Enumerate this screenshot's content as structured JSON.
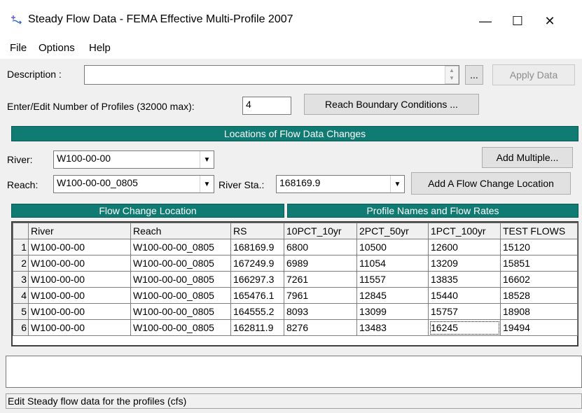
{
  "window": {
    "title": "Steady Flow Data - FEMA Effective Multi-Profile 2007",
    "minimize": "—",
    "maximize": "☐",
    "close": "✕"
  },
  "menu": [
    "File",
    "Options",
    "Help"
  ],
  "description": {
    "label": "Description :",
    "value": "",
    "ellipsis": "...",
    "apply_label": "Apply Data"
  },
  "profiles": {
    "label": "Enter/Edit Number of Profiles (32000 max):",
    "value": "4",
    "reach_bc_label": "Reach Boundary Conditions ..."
  },
  "locations": {
    "header": "Locations of Flow Data Changes",
    "river_label": "River:",
    "river_value": "W100-00-00",
    "reach_label": "Reach:",
    "reach_value": "W100-00-00_0805",
    "river_sta_label": "River Sta.:",
    "river_sta_value": "168169.9",
    "add_multiple_label": "Add Multiple...",
    "add_location_label": "Add A Flow Change Location"
  },
  "grid": {
    "left_header": "Flow Change Location",
    "right_header": "Profile Names and Flow Rates",
    "columns": [
      "River",
      "Reach",
      "RS",
      "10PCT_10yr",
      "2PCT_50yr",
      "1PCT_100yr",
      "TEST FLOWS"
    ],
    "rows": [
      [
        "1",
        "W100-00-00",
        "W100-00-00_0805",
        "168169.9",
        "6800",
        "10500",
        "12600",
        "15120"
      ],
      [
        "2",
        "W100-00-00",
        "W100-00-00_0805",
        "167249.9",
        "6989",
        "11054",
        "13209",
        "15851"
      ],
      [
        "3",
        "W100-00-00",
        "W100-00-00_0805",
        "166297.3",
        "7261",
        "11557",
        "13835",
        "16602"
      ],
      [
        "4",
        "W100-00-00",
        "W100-00-00_0805",
        "165476.1",
        "7961",
        "12845",
        "15440",
        "18528"
      ],
      [
        "5",
        "W100-00-00",
        "W100-00-00_0805",
        "164555.2",
        "8093",
        "13099",
        "15757",
        "18908"
      ],
      [
        "6",
        "W100-00-00",
        "W100-00-00_0805",
        "162811.9",
        "8276",
        "13483",
        "16245",
        "19494"
      ]
    ]
  },
  "status": "Edit Steady flow data for the profiles (cfs)",
  "colors": {
    "section_header": "#0f7b73"
  }
}
